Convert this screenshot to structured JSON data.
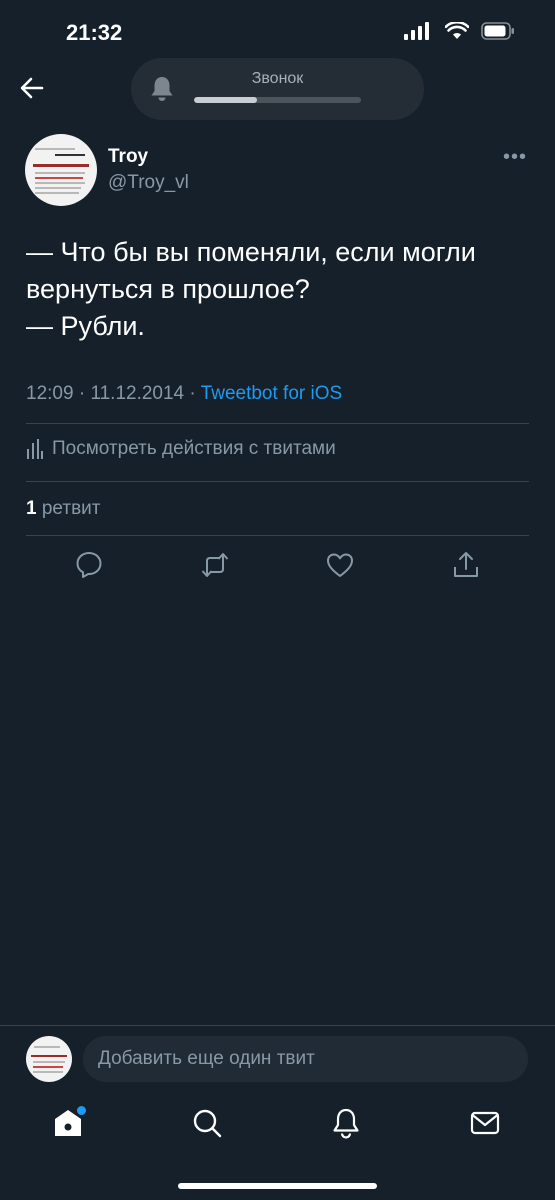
{
  "status_bar": {
    "time": "21:32"
  },
  "call_pill": {
    "label": "Звонок",
    "progress": 0.38
  },
  "tweet": {
    "author_name": "Troy",
    "author_handle": "@Troy_vl",
    "more_label": "•••",
    "text_lines": [
      "— Что бы вы поменяли, если могли",
      "вернуться в прошлое?",
      "— Рубли."
    ],
    "time": "12:09",
    "date": "11.12.2014",
    "separator": " · ",
    "source": "Tweetbot for iOS",
    "activity_label": "Посмотреть действия с твитами",
    "retweet_count": "1",
    "retweet_label": "ретвит"
  },
  "compose": {
    "placeholder": "Добавить еще один твит"
  },
  "colors": {
    "background": "#15202b",
    "accent": "#1d9bf0",
    "secondary_text": "#8899a6",
    "divider": "#38444d"
  },
  "icons": {
    "back": "arrow-left-icon",
    "bell": "bell-icon",
    "reply": "reply-icon",
    "retweet": "retweet-icon",
    "like": "heart-icon",
    "share": "share-icon",
    "home": "home-icon",
    "search": "search-icon",
    "notifications": "bell-icon",
    "messages": "mail-icon"
  }
}
